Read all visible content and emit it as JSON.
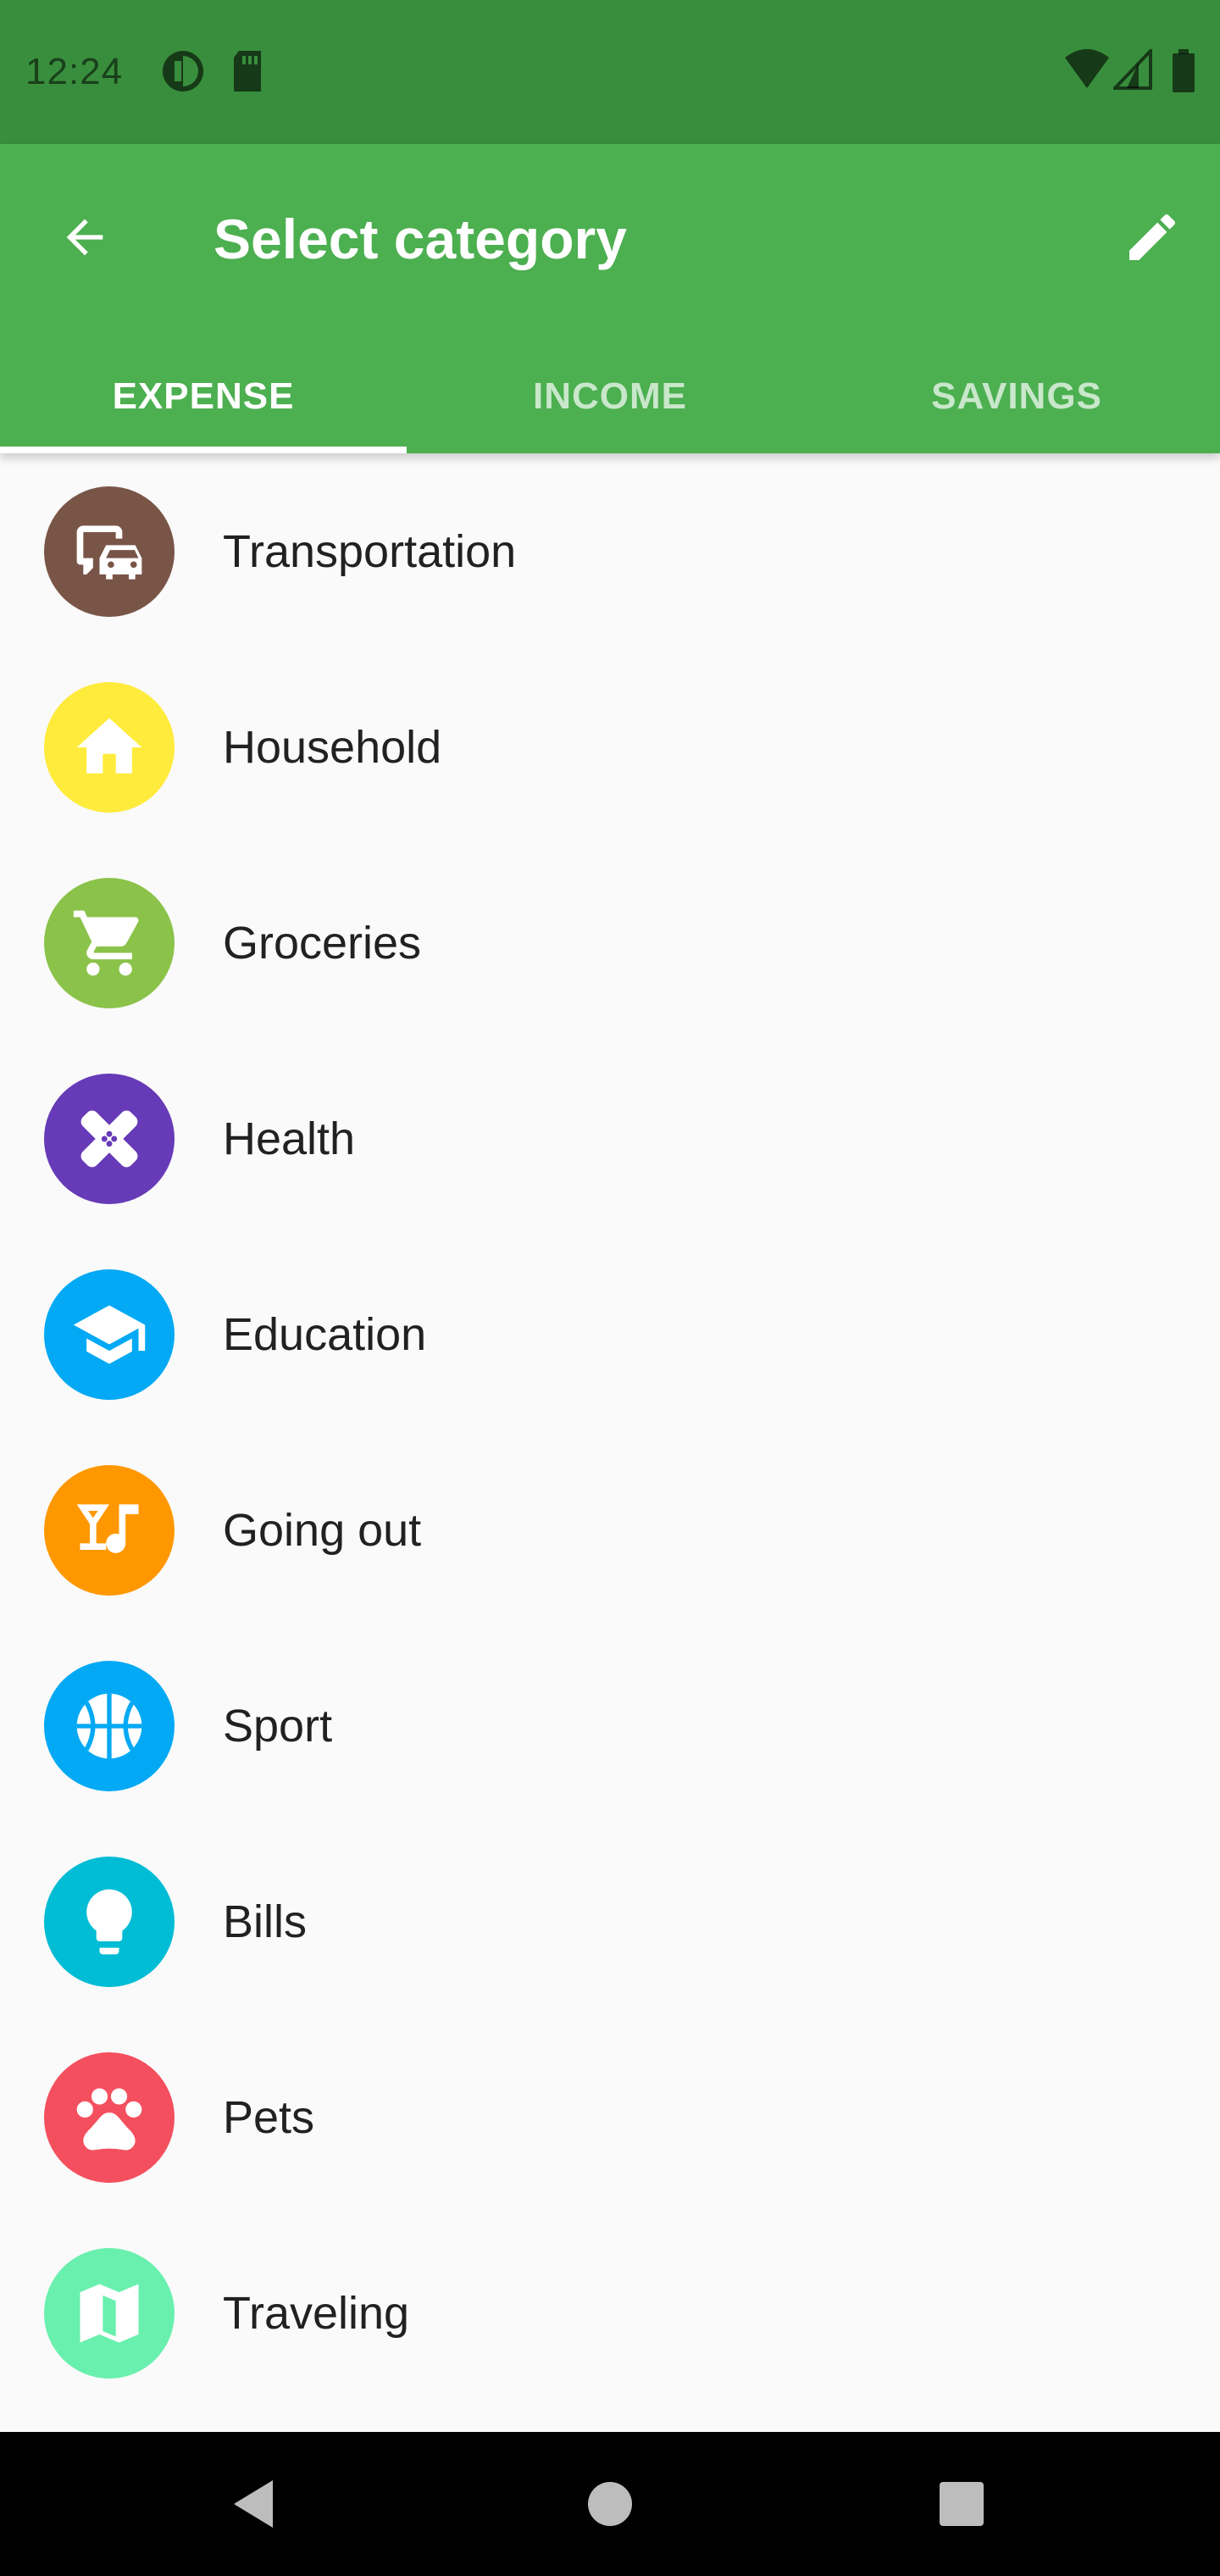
{
  "status_bar": {
    "time": "12:24"
  },
  "app_bar": {
    "title": "Select category",
    "back_icon": "arrow-back-icon",
    "edit_icon": "pencil-icon",
    "background": "#4caf50",
    "status_background": "#388e3c"
  },
  "tabs": [
    {
      "label": "EXPENSE",
      "active": true
    },
    {
      "label": "INCOME",
      "active": false
    },
    {
      "label": "SAVINGS",
      "active": false
    }
  ],
  "categories": [
    {
      "label": "Transportation",
      "icon": "transportation-icon",
      "color": "#795548"
    },
    {
      "label": "Household",
      "icon": "house-icon",
      "color": "#ffeb3b"
    },
    {
      "label": "Groceries",
      "icon": "shopping-cart-icon",
      "color": "#8bc34a"
    },
    {
      "label": "Health",
      "icon": "bandage-icon",
      "color": "#673ab7"
    },
    {
      "label": "Education",
      "icon": "graduation-cap-icon",
      "color": "#03a9f4"
    },
    {
      "label": "Going out",
      "icon": "cocktail-music-icon",
      "color": "#ff9800"
    },
    {
      "label": "Sport",
      "icon": "basketball-icon",
      "color": "#03a9f4"
    },
    {
      "label": "Bills",
      "icon": "lightbulb-icon",
      "color": "#00bcd4"
    },
    {
      "label": "Pets",
      "icon": "paw-icon",
      "color": "#f44f5e"
    },
    {
      "label": "Traveling",
      "icon": "map-icon",
      "color": "#69f0ae"
    }
  ],
  "nav_bar": {
    "back_icon": "nav-back-icon",
    "home_icon": "nav-home-icon",
    "recents_icon": "nav-recents-icon"
  }
}
